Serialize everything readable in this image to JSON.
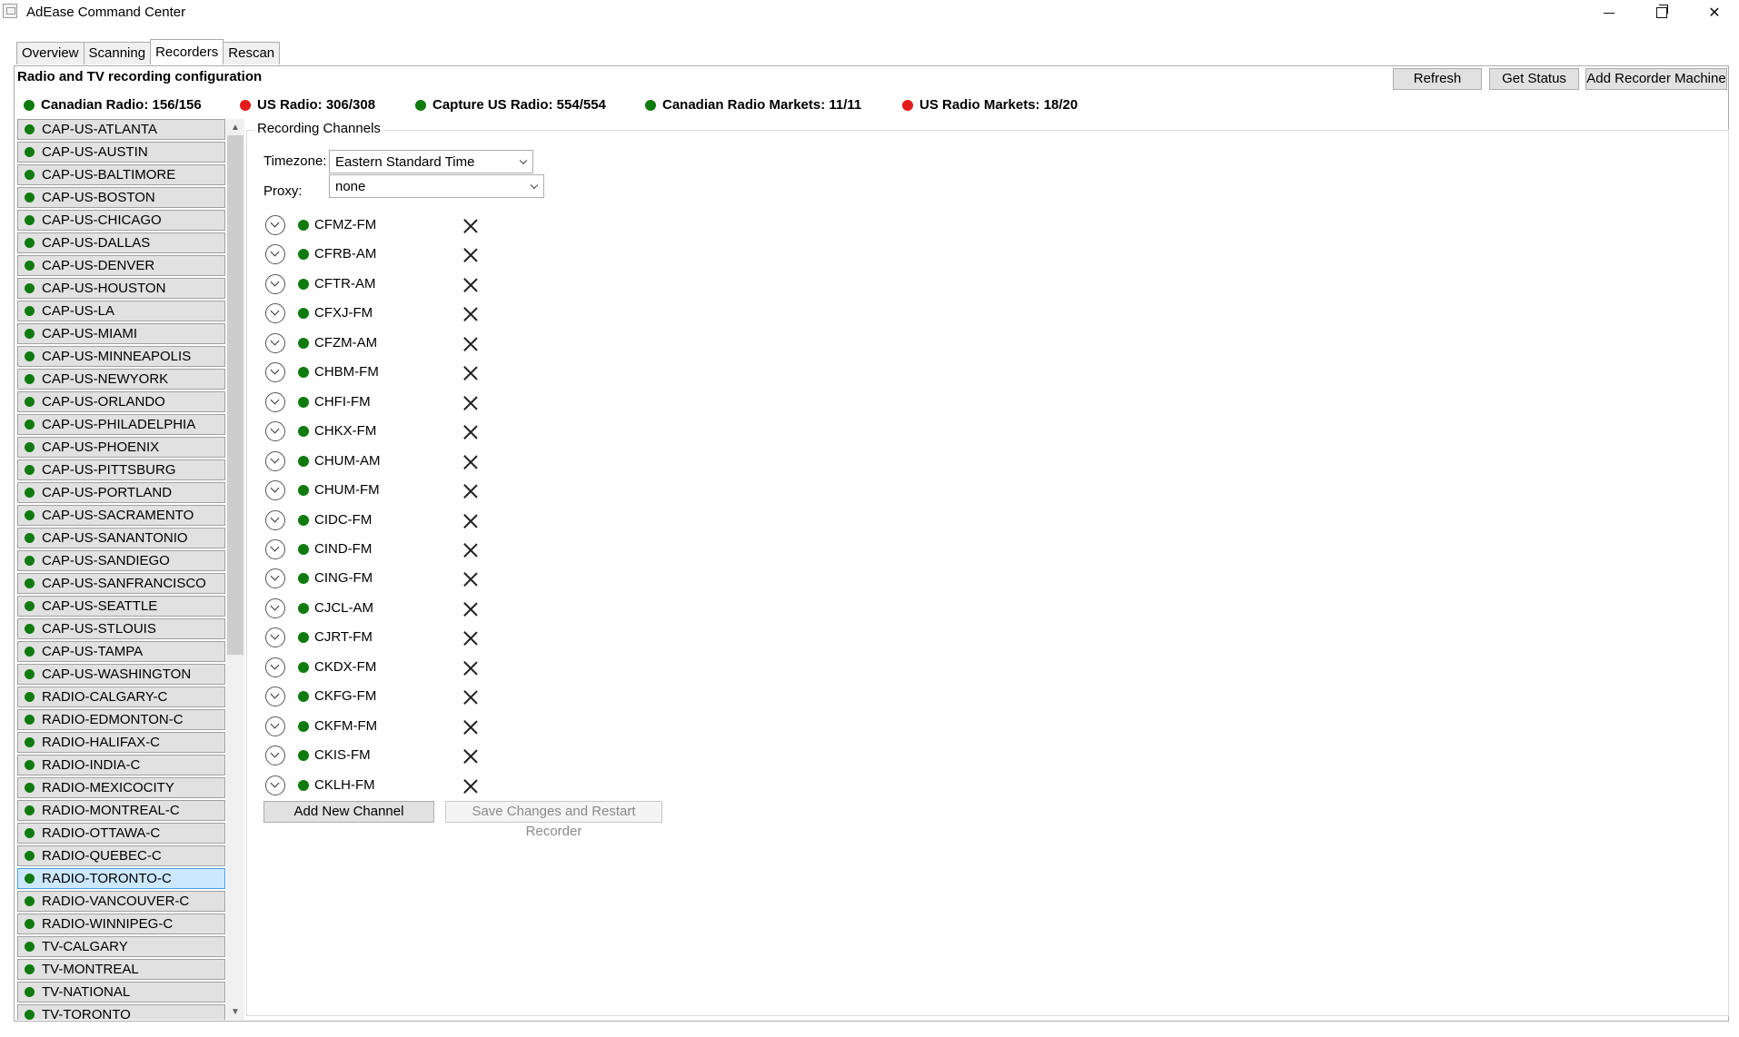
{
  "window": {
    "title": "AdEase Command Center"
  },
  "tabs": [
    {
      "label": "Overview",
      "active": false
    },
    {
      "label": "Scanning",
      "active": false
    },
    {
      "label": "Recorders",
      "active": true
    },
    {
      "label": "Rescan",
      "active": false
    }
  ],
  "section_title": "Radio and TV recording configuration",
  "toolbar": {
    "refresh": "Refresh",
    "get_status": "Get Status",
    "add_machine": "Add Recorder Machine"
  },
  "status": [
    {
      "label": "Canadian Radio: 156/156",
      "color": "green"
    },
    {
      "label": "US Radio: 306/308",
      "color": "red"
    },
    {
      "label": "Capture US Radio: 554/554",
      "color": "green"
    },
    {
      "label": "Canadian Radio Markets: 11/11",
      "color": "green"
    },
    {
      "label": "US Radio Markets: 18/20",
      "color": "red"
    }
  ],
  "recorders": [
    "CAP-US-ATLANTA",
    "CAP-US-AUSTIN",
    "CAP-US-BALTIMORE",
    "CAP-US-BOSTON",
    "CAP-US-CHICAGO",
    "CAP-US-DALLAS",
    "CAP-US-DENVER",
    "CAP-US-HOUSTON",
    "CAP-US-LA",
    "CAP-US-MIAMI",
    "CAP-US-MINNEAPOLIS",
    "CAP-US-NEWYORK",
    "CAP-US-ORLANDO",
    "CAP-US-PHILADELPHIA",
    "CAP-US-PHOENIX",
    "CAP-US-PITTSBURG",
    "CAP-US-PORTLAND",
    "CAP-US-SACRAMENTO",
    "CAP-US-SANANTONIO",
    "CAP-US-SANDIEGO",
    "CAP-US-SANFRANCISCO",
    "CAP-US-SEATTLE",
    "CAP-US-STLOUIS",
    "CAP-US-TAMPA",
    "CAP-US-WASHINGTON",
    "RADIO-CALGARY-C",
    "RADIO-EDMONTON-C",
    "RADIO-HALIFAX-C",
    "RADIO-INDIA-C",
    "RADIO-MEXICOCITY",
    "RADIO-MONTREAL-C",
    "RADIO-OTTAWA-C",
    "RADIO-QUEBEC-C",
    "RADIO-TORONTO-C",
    "RADIO-VANCOUVER-C",
    "RADIO-WINNIPEG-C",
    "TV-CALGARY",
    "TV-MONTREAL",
    "TV-NATIONAL",
    "TV-TORONTO"
  ],
  "selected_recorder": "RADIO-TORONTO-C",
  "colors": {
    "green": "#0f7b0f",
    "red": "#e61a1a",
    "selected": "#cce8ff"
  },
  "channels_panel": {
    "title": "Recording Channels",
    "timezone_label": "Timezone:",
    "timezone_value": "Eastern Standard Time",
    "proxy_label": "Proxy:",
    "proxy_value": "none",
    "channels": [
      "CFMZ-FM",
      "CFRB-AM",
      "CFTR-AM",
      "CFXJ-FM",
      "CFZM-AM",
      "CHBM-FM",
      "CHFI-FM",
      "CHKX-FM",
      "CHUM-AM",
      "CHUM-FM",
      "CIDC-FM",
      "CIND-FM",
      "CING-FM",
      "CJCL-AM",
      "CJRT-FM",
      "CKDX-FM",
      "CKFG-FM",
      "CKFM-FM",
      "CKIS-FM",
      "CKLH-FM"
    ],
    "add_channel": "Add New Channel",
    "save_restart": "Save Changes and Restart Recorder"
  },
  "icons": {
    "expand": "chevron-down-circle-icon",
    "remove": "close-x-icon",
    "status": "status-dot-icon"
  }
}
